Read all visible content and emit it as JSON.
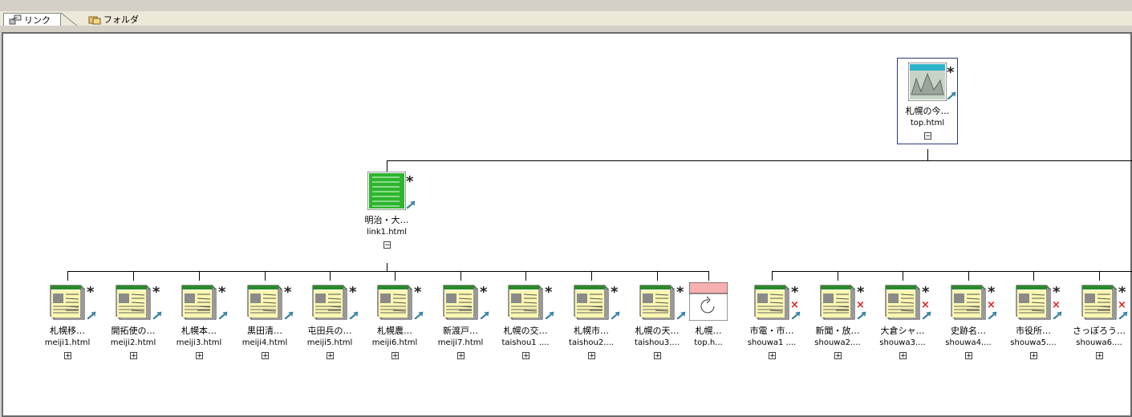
{
  "top_note": "　　　　　　　　　　　　　　　　　　　　　　　　　",
  "tabs": [
    {
      "label": "リンク",
      "icon": "link-icon",
      "active": true
    },
    {
      "label": "フォルダ",
      "icon": "folder-icon",
      "active": false
    }
  ],
  "root": {
    "title": "札幌の今…",
    "file": "top.html",
    "status": "expanded"
  },
  "level1": {
    "title": "明治・大…",
    "file": "link1.html",
    "status": "expanded"
  },
  "children": [
    {
      "title": "札幌移…",
      "file": "meiji1.html",
      "error": false
    },
    {
      "title": "開拓使の…",
      "file": "meiji2.html",
      "error": false
    },
    {
      "title": "札幌本…",
      "file": "meiji3.html",
      "error": false
    },
    {
      "title": "黒田清…",
      "file": "meiji4.html",
      "error": false
    },
    {
      "title": "屯田兵の…",
      "file": "meiji5.html",
      "error": false
    },
    {
      "title": "札幌農…",
      "file": "meiji6.html",
      "error": false
    },
    {
      "title": "新渡戸…",
      "file": "meiji7.html",
      "error": false
    },
    {
      "title": "札幌の交…",
      "file": "taishou1 ....",
      "error": false
    },
    {
      "title": "札幌市…",
      "file": "taishou2....",
      "error": false
    },
    {
      "title": "札幌の天…",
      "file": "taishou3....",
      "error": false
    },
    {
      "title": "札幌…",
      "file": "top.h...",
      "loop": true
    },
    {
      "title": "市電・市…",
      "file": "shouwa1 ....",
      "error": true
    },
    {
      "title": "新聞・放…",
      "file": "shouwa2....",
      "error": true
    },
    {
      "title": "大倉シャ…",
      "file": "shouwa3....",
      "error": true
    },
    {
      "title": "史跡名…",
      "file": "shouwa4....",
      "error": true
    },
    {
      "title": "市役所…",
      "file": "shouwa5....",
      "error": true
    },
    {
      "title": "さっぽろう…",
      "file": "shouwa6....",
      "error": true
    }
  ],
  "colors": {
    "page_green": "#2db52d",
    "page_yellow": "#fbf7b0",
    "error_red": "#e02020",
    "loop_pink": "#f7b0b0"
  }
}
